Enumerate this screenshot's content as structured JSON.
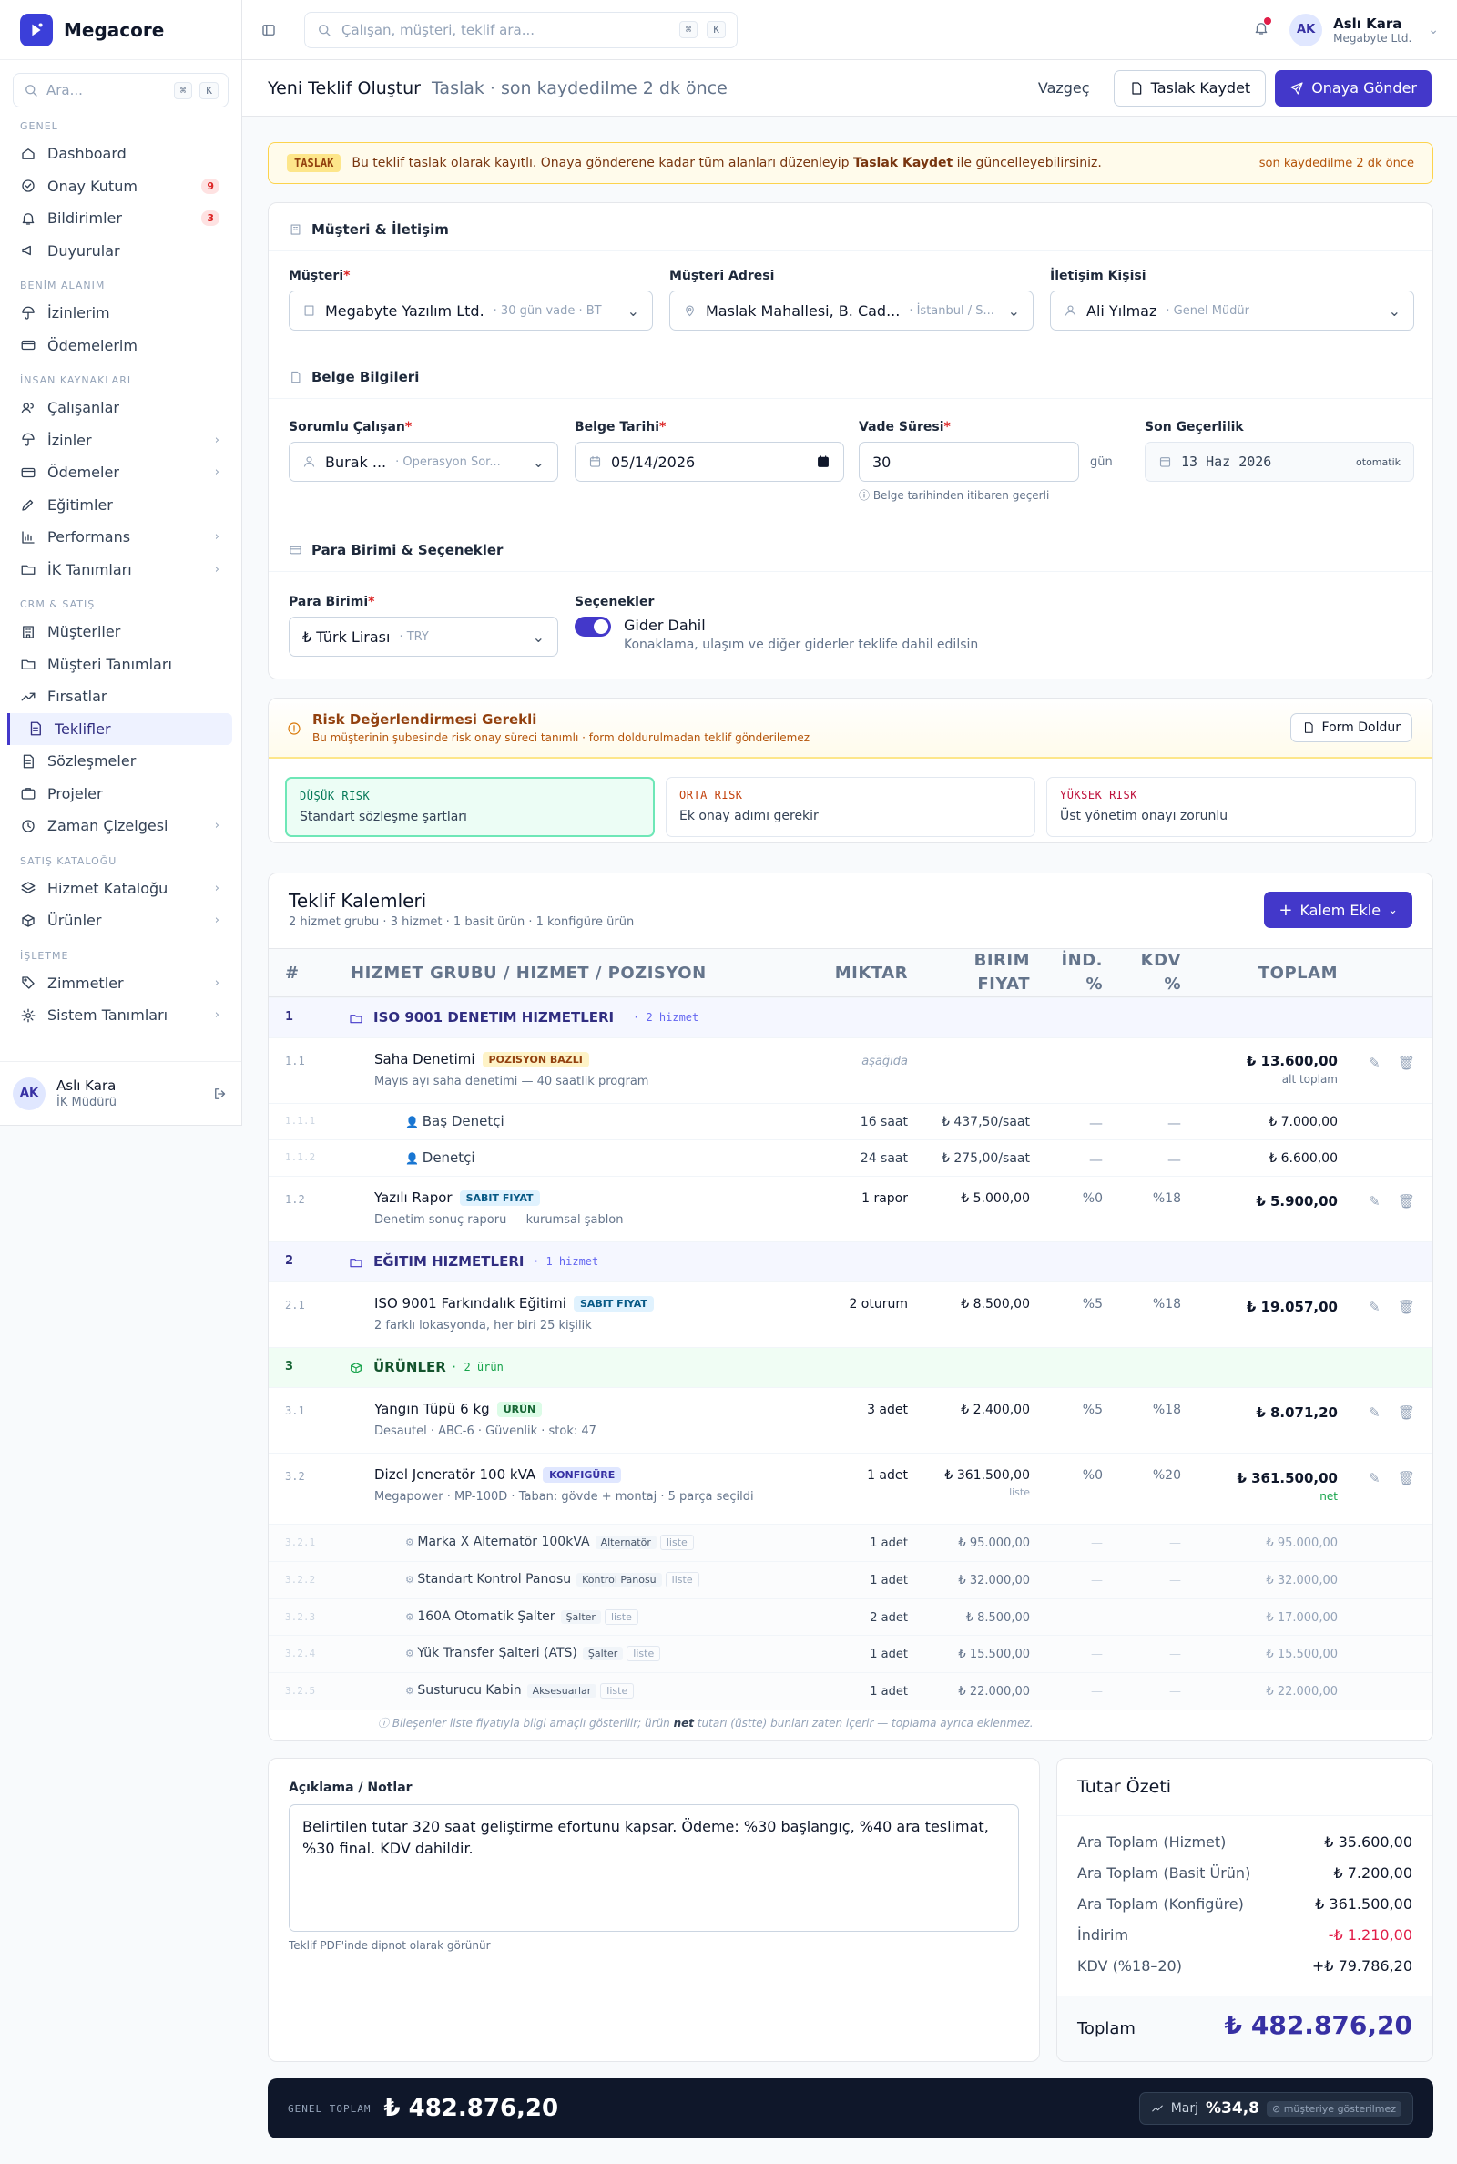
{
  "brand": {
    "name": "Megacore"
  },
  "sidebar": {
    "search_placeholder": "Ara...",
    "kbd1": "⌘",
    "kbd2": "K",
    "sections": {
      "general": "GENEL",
      "personal": "BENİM ALANIM",
      "hr": "İNSAN KAYNAKLARI",
      "crm": "CRM & SATIŞ",
      "catalog": "SATIŞ KATALOĞU",
      "ops": "İŞLETME"
    },
    "items": {
      "dashboard": "Dashboard",
      "inbox": "Onay Kutum",
      "inbox_badge": "9",
      "notifications": "Bildirimler",
      "notifications_badge": "3",
      "announcements": "Duyurular",
      "my_leaves": "İzinlerim",
      "my_payments": "Ödemelerim",
      "employees": "Çalışanlar",
      "leaves": "İzinler",
      "payments": "Ödemeler",
      "trainings": "Eğitimler",
      "performance": "Performans",
      "hr_defs": "İK Tanımları",
      "customers": "Müşteriler",
      "customer_defs": "Müşteri Tanımları",
      "opportunities": "Fırsatlar",
      "offers": "Teklifler",
      "contracts": "Sözleşmeler",
      "projects": "Projeler",
      "timesheet": "Zaman Çizelgesi",
      "service_catalog": "Hizmet Kataloğu",
      "products": "Ürünler",
      "assets": "Zimmetler",
      "system_defs": "Sistem Tanımları"
    },
    "user": {
      "initials": "AK",
      "name": "Aslı Kara",
      "role": "İK Müdürü"
    }
  },
  "topbar": {
    "search_placeholder": "Çalışan, müşteri, teklif ara...",
    "kbd1": "⌘",
    "kbd2": "K",
    "user_initials": "AK",
    "user_name": "Aslı Kara",
    "user_company": "Megabyte Ltd."
  },
  "page": {
    "title": "Yeni Teklif Oluştur",
    "subtitle": "Taslak · son kaydedilme 2 dk önce",
    "cancel": "Vazgeç",
    "save_draft": "Taslak Kaydet",
    "submit": "Onaya Gönder"
  },
  "draft_banner": {
    "tag": "TASLAK",
    "text_a": "Bu teklif taslak olarak kayıtlı. Onaya gönderene kadar tüm alanları düzenleyip ",
    "text_bold": "Taslak Kaydet",
    "text_b": " ile güncelleyebilirsiniz.",
    "right": "son kaydedilme 2 dk önce"
  },
  "customer": {
    "section": "Müşteri & İletişim",
    "customer_label": "Müşteri",
    "customer_value": "Megabyte Yazılım Ltd.",
    "customer_meta": "· 30 gün vade · BT",
    "address_label": "Müşteri Adresi",
    "address_value": "Maslak Mahallesi, B. Cad...",
    "address_meta": "· İstanbul / S...",
    "contact_label": "İletişim Kişisi",
    "contact_value": "Ali Yılmaz",
    "contact_meta": "· Genel Müdür"
  },
  "doc": {
    "section": "Belge Bilgileri",
    "owner_label": "Sorumlu Çalışan",
    "owner_value": "Burak ...",
    "owner_meta": "· Operasyon Sor...",
    "date_label": "Belge Tarihi",
    "date_value": "05/14/2026",
    "term_label": "Vade Süresi",
    "term_value": "30",
    "term_unit": "gün",
    "term_hint": "Belge tarihinden itibaren geçerli",
    "valid_label": "Son Geçerlilik",
    "valid_value": "13 Haz 2026",
    "valid_auto": "otomatik"
  },
  "currency": {
    "section": "Para Birimi & Seçenekler",
    "label": "Para Birimi",
    "value": "₺ Türk Lirası",
    "meta": "· TRY",
    "options_label": "Seçenekler",
    "toggle_label": "Gider Dahil",
    "toggle_hint": "Konaklama, ulaşım ve diğer giderler teklife dahil edilsin"
  },
  "risk": {
    "title": "Risk Değerlendirmesi Gerekli",
    "subtitle": "Bu müşterinin şubesinde risk onay süreci tanımlı · form doldurulmadan teklif gönderilemez",
    "button": "Form Doldur",
    "low_t": "DÜŞÜK RISK",
    "low_d": "Standart sözleşme şartları",
    "mid_t": "ORTA RISK",
    "mid_d": "Ek onay adımı gerekir",
    "high_t": "YÜKSEK RISK",
    "high_d": "Üst yönetim onayı zorunlu"
  },
  "items": {
    "title": "Teklif Kalemleri",
    "subtitle": "2 hizmet grubu · 3 hizmet · 1 basit ürün · 1 konfigüre ürün",
    "add": "Kalem Ekle",
    "h_no": "#",
    "h_name": "HIZMET GRUBU / HIZMET / POZISYON",
    "h_qty": "MIKTAR",
    "h_price_a": "BIRIM",
    "h_price_b": "FIYAT",
    "h_disc_a": "İND.",
    "h_disc_b": "%",
    "h_vat_a": "KDV",
    "h_vat_b": "%",
    "h_total": "TOPLAM",
    "g1": {
      "no": "1",
      "name": "ISO 9001 DENETIM HIZMETLERI",
      "count": "· 2 hizmet"
    },
    "r11": {
      "no": "1.1",
      "name": "Saha Denetimi",
      "tag": "POZISYON BAZLI",
      "desc": "Mayıs ayı saha denetimi — 40 saatlik program",
      "qty": "aşağıda",
      "total": "₺ 13.600,00",
      "total_sub": "alt toplam"
    },
    "r111": {
      "no": "1.1.1",
      "name": "Baş Denetçi",
      "qty": "16 saat",
      "price": "₺ 437,50/saat",
      "disc": "—",
      "vat": "—",
      "total": "₺ 7.000,00"
    },
    "r112": {
      "no": "1.1.2",
      "name": "Denetçi",
      "qty": "24 saat",
      "price": "₺ 275,00/saat",
      "disc": "—",
      "vat": "—",
      "total": "₺ 6.600,00"
    },
    "r12": {
      "no": "1.2",
      "name": "Yazılı Rapor",
      "tag": "SABIT FIYAT",
      "desc": "Denetim sonuç raporu — kurumsal şablon",
      "qty": "1 rapor",
      "price": "₺ 5.000,00",
      "disc": "%0",
      "vat": "%18",
      "total": "₺ 5.900,00"
    },
    "g2": {
      "no": "2",
      "name": "EĞITIM HIZMETLERI",
      "count": "· 1 hizmet"
    },
    "r21": {
      "no": "2.1",
      "name": "ISO 9001 Farkındalık Eğitimi",
      "tag": "SABIT FIYAT",
      "desc": "2 farklı lokasyonda, her biri 25 kişilik",
      "qty": "2 oturum",
      "price": "₺ 8.500,00",
      "disc": "%5",
      "vat": "%18",
      "total": "₺ 19.057,00"
    },
    "g3": {
      "no": "3",
      "name": "ÜRÜNLER",
      "count": "· 2 ürün"
    },
    "r31": {
      "no": "3.1",
      "name": "Yangın Tüpü 6 kg",
      "tag": "ÜRÜN",
      "desc": "Desautel · ABC-6 · Güvenlik · stok: 47",
      "qty": "3 adet",
      "price": "₺ 2.400,00",
      "disc": "%5",
      "vat": "%18",
      "total": "₺ 8.071,20"
    },
    "r32": {
      "no": "3.2",
      "name": "Dizel Jeneratör 100 kVA",
      "tag": "KONFIGÜRE",
      "desc": "Megapower · MP-100D · Taban: gövde + montaj · 5 parça seçildi",
      "qty": "1 adet",
      "price": "₺ 361.500,00",
      "price_sub": "liste",
      "disc": "%0",
      "vat": "%20",
      "total": "₺ 361.500,00",
      "total_sub": "net"
    },
    "components": [
      {
        "no": "3.2.1",
        "name": "Marka X Alternatör 100kVA",
        "cat": "Alternatör",
        "list": "liste",
        "qty": "1 adet",
        "price": "₺ 95.000,00",
        "disc": "—",
        "vat": "—",
        "total": "₺ 95.000,00"
      },
      {
        "no": "3.2.2",
        "name": "Standart Kontrol Panosu",
        "cat": "Kontrol Panosu",
        "list": "liste",
        "qty": "1 adet",
        "price": "₺ 32.000,00",
        "disc": "—",
        "vat": "—",
        "total": "₺ 32.000,00"
      },
      {
        "no": "3.2.3",
        "name": "160A Otomatik Şalter",
        "cat": "Şalter",
        "list": "liste",
        "qty": "2 adet",
        "price": "₺ 8.500,00",
        "disc": "—",
        "vat": "—",
        "total": "₺ 17.000,00"
      },
      {
        "no": "3.2.4",
        "name": "Yük Transfer Şalteri (ATS)",
        "cat": "Şalter",
        "list": "liste",
        "qty": "1 adet",
        "price": "₺ 15.500,00",
        "disc": "—",
        "vat": "—",
        "total": "₺ 15.500,00"
      },
      {
        "no": "3.2.5",
        "name": "Susturucu Kabin",
        "cat": "Aksesuarlar",
        "list": "liste",
        "qty": "1 adet",
        "price": "₺ 22.000,00",
        "disc": "—",
        "vat": "—",
        "total": "₺ 22.000,00"
      }
    ],
    "note_a": "Bileşenler liste fiyatıyla bilgi amaçlı gösterilir; ürün ",
    "note_bold": "net",
    "note_b": " tutarı (üstte) bunları zaten içerir — toplama ayrıca eklenmez."
  },
  "notes": {
    "label": "Açıklama / Notlar",
    "value": "Belirtilen tutar 320 saat geliştirme efortunu kapsar. Ödeme: %30 başlangıç, %40 ara teslimat, %30 final. KDV dahildir.",
    "hint": "Teklif PDF'inde dipnot olarak görünür"
  },
  "summary": {
    "title": "Tutar Özeti",
    "r1_l": "Ara Toplam (Hizmet)",
    "r1_v": "₺ 35.600,00",
    "r2_l": "Ara Toplam (Basit Ürün)",
    "r2_v": "₺ 7.200,00",
    "r3_l": "Ara Toplam (Konfigüre)",
    "r3_v": "₺ 361.500,00",
    "r4_l": "İndirim",
    "r4_v": "-₺ 1.210,00",
    "r5_l": "KDV (%18–20)",
    "r5_v": "+₺ 79.786,20",
    "total_l": "Toplam",
    "total_v": "₺ 482.876,20"
  },
  "footer": {
    "label": "GENEL TOPLAM",
    "total": "₺ 482.876,20",
    "margin_label": "Marj",
    "margin_value": "%34,8",
    "margin_note": "müşteriye gösterilmez"
  }
}
